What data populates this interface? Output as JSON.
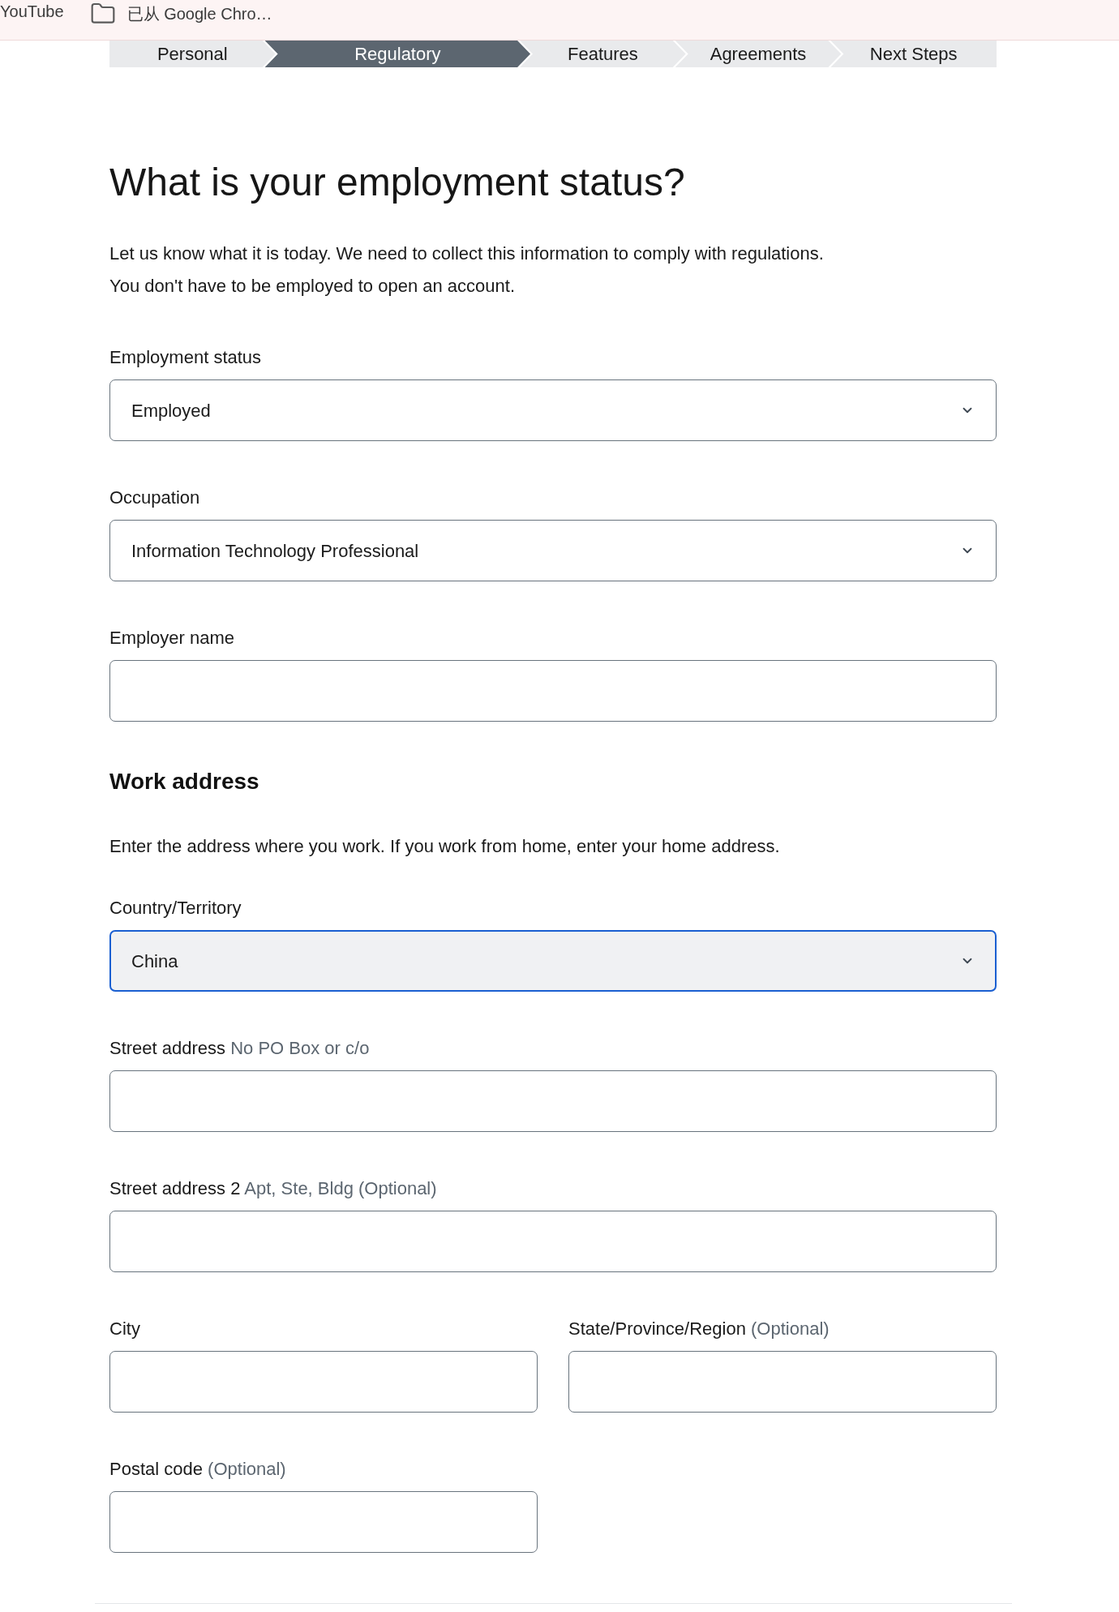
{
  "bookmarks_bar": {
    "items": [
      {
        "kind": "link",
        "label": "YouTube"
      },
      {
        "kind": "folder",
        "label": "已从 Google Chro…"
      }
    ]
  },
  "steps": [
    {
      "label": "Personal",
      "selected": false
    },
    {
      "label": "Regulatory",
      "selected": true
    },
    {
      "label": "Features",
      "selected": false
    },
    {
      "label": "Agreements",
      "selected": false
    },
    {
      "label": "Next Steps",
      "selected": false
    }
  ],
  "heading": "What is your employment status?",
  "intro": [
    "Let us know what it is today. We need to collect this information to comply with regulations.",
    "You don't have to be employed to open an account."
  ],
  "employment_fields": [
    {
      "kind": "select",
      "label": "Employment status",
      "value": "Employed",
      "focused": false
    },
    {
      "kind": "select",
      "label": "Occupation",
      "value": "Information Technology Professional",
      "focused": false
    },
    {
      "kind": "text",
      "label": "Employer name",
      "focused": false
    }
  ],
  "work_address": {
    "heading": "Work address",
    "description": "Enter the address where you work. If you work from home, enter your home address.",
    "fields": [
      {
        "kind": "select",
        "label": "Country/Territory",
        "value": "China",
        "focused": true
      },
      {
        "kind": "text",
        "label": "Street address",
        "hint": "No PO Box or c/o",
        "focused": false
      },
      {
        "kind": "text",
        "label": "Street address 2",
        "hint": "Apt, Ste, Bldg (Optional)",
        "focused": false
      }
    ],
    "paired_fields": [
      {
        "kind": "text",
        "label": "City",
        "focused": false
      },
      {
        "kind": "text",
        "label": "State/Province/Region",
        "hint": "(Optional)",
        "focused": false
      },
      {
        "kind": "text",
        "label": "Postal code",
        "hint": "(Optional)",
        "focused": false
      }
    ]
  }
}
